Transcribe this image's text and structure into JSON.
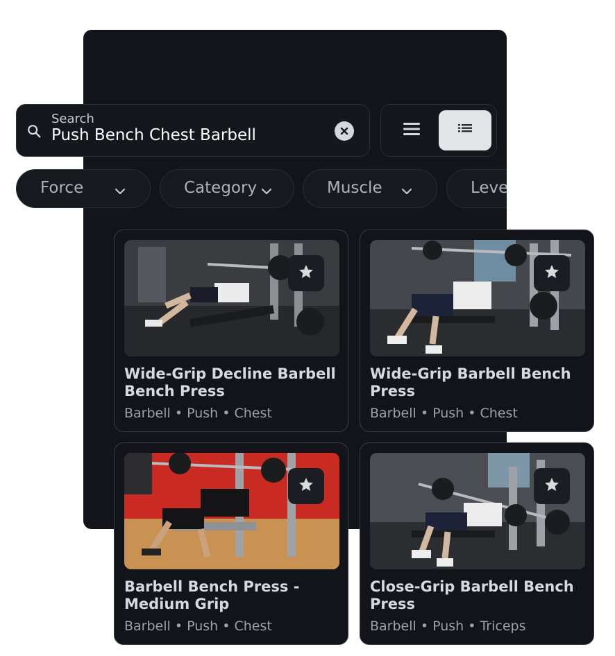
{
  "search": {
    "label": "Search",
    "value": "Push Bench Chest Barbell"
  },
  "filters": [
    {
      "label": "Force"
    },
    {
      "label": "Category"
    },
    {
      "label": "Muscle"
    },
    {
      "label": "Level"
    }
  ],
  "view_modes": [
    {
      "name": "list",
      "icon": "menu-icon",
      "selected": false
    },
    {
      "name": "detail",
      "icon": "detail-list-icon",
      "selected": true
    }
  ],
  "cards": [
    {
      "title": "Wide-Grip Decline Barbell Bench Press",
      "meta": "Barbell • Push • Chest"
    },
    {
      "title": "Wide-Grip Barbell Bench Press",
      "meta": "Barbell • Push • Chest"
    },
    {
      "title": "Barbell Bench Press - Medium Grip",
      "meta": "Barbell • Push • Chest"
    },
    {
      "title": "Close-Grip Barbell Bench Press",
      "meta": "Barbell • Push • Triceps"
    }
  ],
  "colors": {
    "panel": "#121419",
    "card_border": "#3a3d44",
    "accent_selected": "#e3e4e6"
  }
}
